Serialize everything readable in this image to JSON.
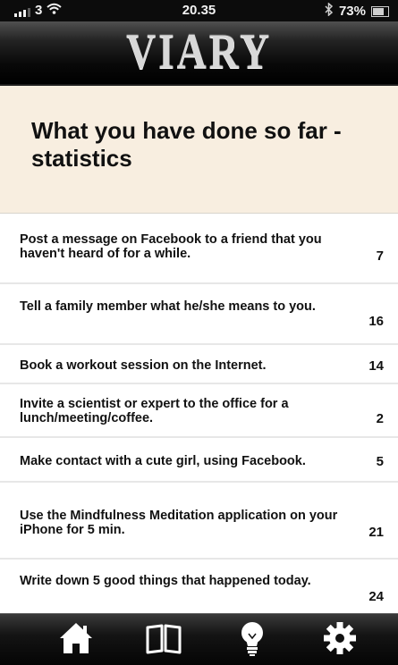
{
  "status_bar": {
    "carrier": "3",
    "time": "20.35",
    "battery": "73%"
  },
  "header": {
    "logo": "VIARY"
  },
  "page": {
    "title": "What you have done so far - statistics"
  },
  "stats": [
    {
      "text": "Post a message on Facebook to a friend that you haven't heard of for a while.",
      "count": "7"
    },
    {
      "text": "Tell a family member what he/she means to you.",
      "count": "16"
    },
    {
      "text": "Book a workout session on the Internet.",
      "count": "14"
    },
    {
      "text": "Invite a scientist or expert to the office for a lunch/meeting/coffee.",
      "count": "2"
    },
    {
      "text": "Make contact with a cute girl, using Facebook.",
      "count": "5"
    },
    {
      "text": "Use the Mindfulness Meditation application on your iPhone for 5 min.",
      "count": "21"
    },
    {
      "text": "Write down 5 good things that happened today.",
      "count": "24"
    }
  ],
  "tab_bar": {
    "tabs": [
      {
        "icon": "home-icon"
      },
      {
        "icon": "book-icon"
      },
      {
        "icon": "lightbulb-icon"
      },
      {
        "icon": "gear-icon"
      }
    ]
  },
  "colors": {
    "title_panel_bg": "#f8eee0",
    "bar_bg": "#0c0c0c",
    "text": "#111111"
  }
}
